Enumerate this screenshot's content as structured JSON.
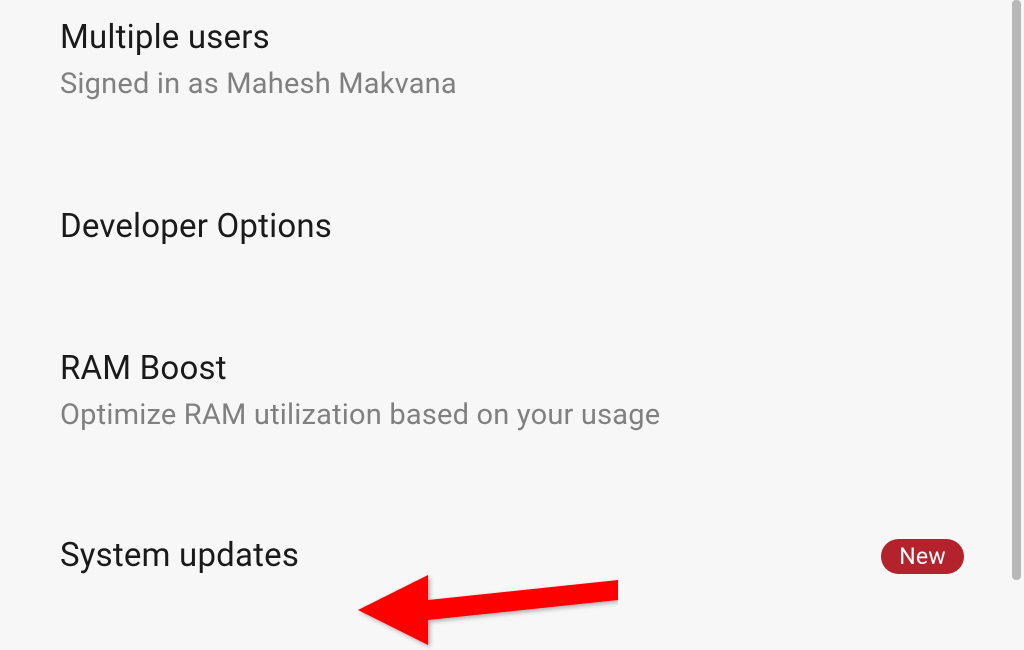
{
  "settings": {
    "items": [
      {
        "title": "Multiple users",
        "subtitle": "Signed in as Mahesh Makvana"
      },
      {
        "title": "Developer Options"
      },
      {
        "title": "RAM Boost",
        "subtitle": "Optimize RAM utilization based on your usage"
      },
      {
        "title": "System updates",
        "badge": "New"
      }
    ]
  }
}
